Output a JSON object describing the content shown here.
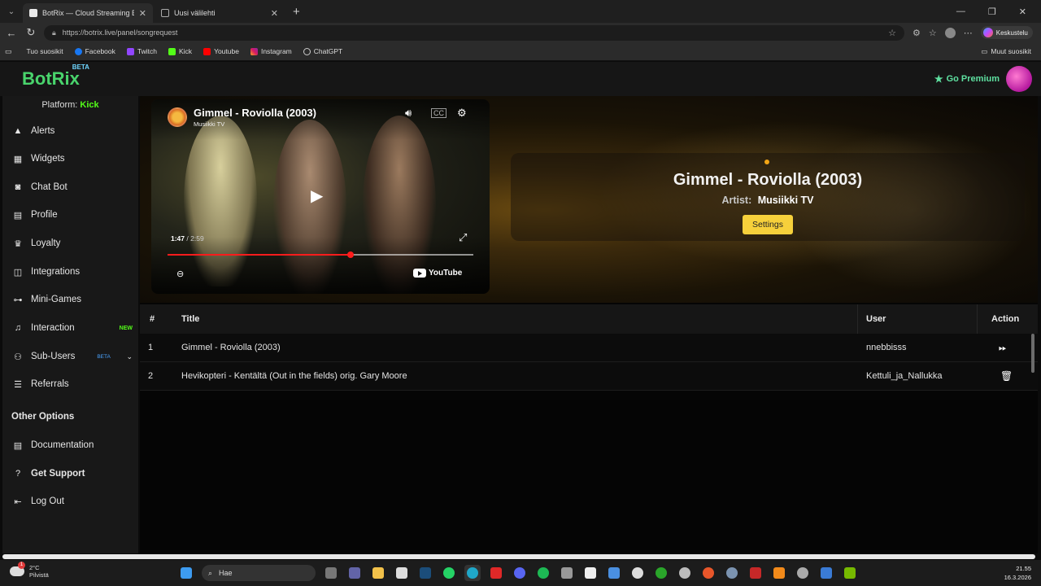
{
  "browser": {
    "tabs": [
      {
        "title": "BotRix — Cloud Streaming Bot for",
        "active": true
      },
      {
        "title": "Uusi välilehti",
        "active": false
      }
    ],
    "url": "https://botrix.live/panel/songrequest",
    "profile_label": "Keskustelu",
    "bookmarks": [
      "Tuo suosikit",
      "Facebook",
      "Twitch",
      "Kick",
      "Youtube",
      "Instagram",
      "ChatGPT"
    ],
    "other_bookmarks": "Muut suosikit"
  },
  "app": {
    "logo": "BotRix",
    "logo_badge": "BETA",
    "premium_label": "Go Premium",
    "accent": "#49d46c"
  },
  "sidebar": {
    "platform_label": "Platform:",
    "platform_value": "Kick",
    "items": [
      {
        "label": "Alerts",
        "icon": "warning-icon"
      },
      {
        "label": "Widgets",
        "icon": "grid-icon"
      },
      {
        "label": "Chat Bot",
        "icon": "robot-icon"
      },
      {
        "label": "Profile",
        "icon": "id-card-icon"
      },
      {
        "label": "Loyalty",
        "icon": "trophy-icon"
      },
      {
        "label": "Integrations",
        "icon": "puzzle-icon"
      },
      {
        "label": "Mini-Games",
        "icon": "gamepad-icon"
      },
      {
        "label": "Interaction",
        "icon": "music-icon",
        "badge": "NEW"
      },
      {
        "label": "Sub-Users",
        "icon": "users-icon",
        "badge": "BETA"
      },
      {
        "label": "Referrals",
        "icon": "list-icon"
      }
    ],
    "other_options_title": "Other Options",
    "other_items": [
      {
        "label": "Documentation",
        "icon": "book-icon"
      },
      {
        "label": "Get Support",
        "icon": "question-icon"
      },
      {
        "label": "Log Out",
        "icon": "logout-icon"
      }
    ]
  },
  "player": {
    "video_title": "Gimmel - Roviolla (2003)",
    "channel": "Musiikki TV",
    "current_time": "1:47",
    "duration": "2:59",
    "progress": 0.598,
    "brand": "YouTube"
  },
  "now_playing": {
    "title": "Gimmel - Roviolla (2003)",
    "artist_label": "Artist:",
    "artist": "Musiikki TV",
    "settings_label": "Settings"
  },
  "queue": {
    "headers": {
      "num": "#",
      "title": "Title",
      "user": "User",
      "action": "Action"
    },
    "rows": [
      {
        "num": "1",
        "title": "Gimmel - Roviolla (2003)",
        "user": "nnebbisss",
        "action": "skip-icon"
      },
      {
        "num": "2",
        "title": "Hevikopteri - Kentältä (Out in the fields) orig. Gary Moore",
        "user": "Kettuli_ja_Nallukka",
        "action": "trash-icon"
      }
    ]
  },
  "taskbar": {
    "weather_temp": "2°C",
    "weather_desc": "Pilvistä",
    "weather_badge": "1",
    "search_placeholder": "Hae",
    "time": "21.55",
    "date": "16.3.2026"
  }
}
